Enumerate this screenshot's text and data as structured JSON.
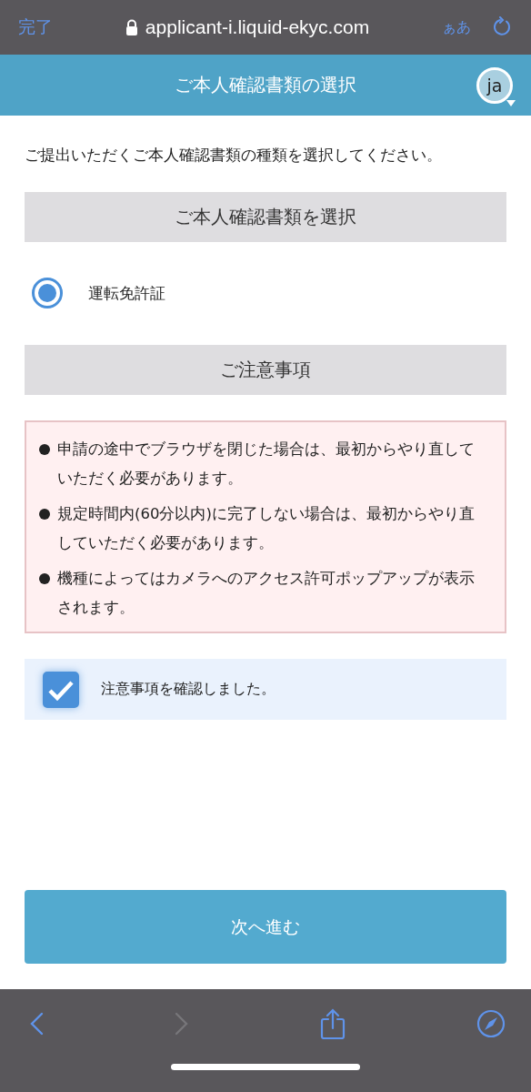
{
  "browser_bar": {
    "done": "完了",
    "url": "applicant-i.liquid-ekyc.com",
    "text_size": "ぁあ"
  },
  "header": {
    "title": "ご本人確認書類の選択",
    "language": "ja"
  },
  "intro": "ご提出いただくご本人確認書類の種類を選択してください。",
  "document_section": {
    "heading": "ご本人確認書類を選択",
    "options": [
      {
        "label": "運転免許証",
        "selected": true
      }
    ]
  },
  "notice_section": {
    "heading": "ご注意事項",
    "notes": [
      "申請の途中でブラウザを閉じた場合は、最初からやり直していただく必要があります。",
      "規定時間内(60分以内)に完了しない場合は、最初からやり直していただく必要があります。",
      "機種によってはカメラへのアクセス許可ポップアップが表示されます。"
    ]
  },
  "confirm": {
    "label": "注意事項を確認しました。",
    "checked": true
  },
  "next_button": "次へ進む",
  "toolbar": {
    "back_disabled": false,
    "forward_disabled": true
  }
}
